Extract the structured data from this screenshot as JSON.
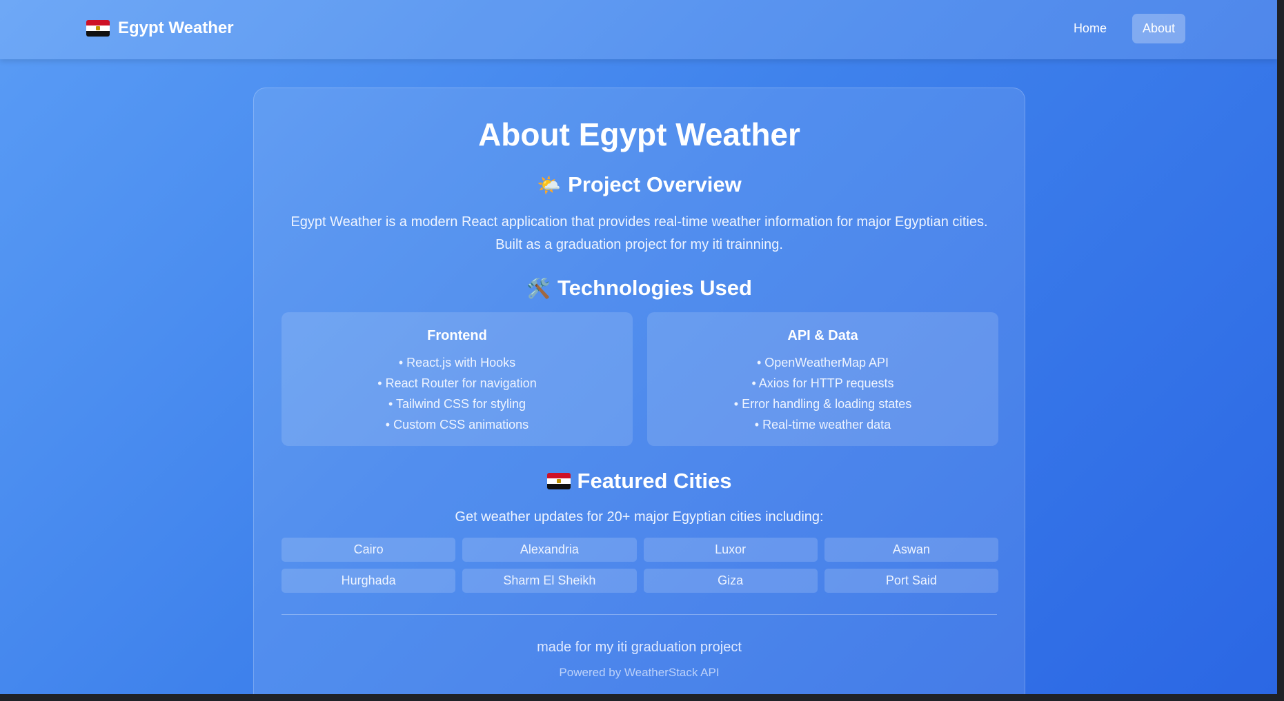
{
  "nav": {
    "brand": "Egypt Weather",
    "links": [
      {
        "label": "Home",
        "active": false
      },
      {
        "label": "About",
        "active": true
      }
    ]
  },
  "about": {
    "title": "About Egypt Weather",
    "overview": {
      "icon": "🌤️",
      "heading": "Project Overview",
      "text": "Egypt Weather is a modern React application that provides real-time weather information for major Egyptian cities. Built as a graduation project for my iti trainning."
    },
    "technologies": {
      "icon": "🛠️",
      "heading": "Technologies Used",
      "frontend": {
        "heading": "Frontend",
        "items": [
          "• React.js with Hooks",
          "• React Router for navigation",
          "• Tailwind CSS for styling",
          "• Custom CSS animations"
        ]
      },
      "api": {
        "heading": "API & Data",
        "items": [
          "• OpenWeatherMap API",
          "• Axios for HTTP requests",
          "• Error handling & loading states",
          "• Real-time weather data"
        ]
      }
    },
    "cities": {
      "icon": "egypt-flag-icon",
      "heading": "Featured Cities",
      "subtitle": "Get weather updates for 20+ major Egyptian cities including:",
      "list": [
        "Cairo",
        "Alexandria",
        "Luxor",
        "Aswan",
        "Hurghada",
        "Sharm El Sheikh",
        "Giza",
        "Port Said"
      ]
    },
    "footer": {
      "main": "made for my iti graduation project",
      "sub": "Powered by WeatherStack API"
    }
  },
  "colors": {
    "bg_start": "#5a9cf5",
    "bg_end": "#2b67e4",
    "text": "#ffffff"
  }
}
